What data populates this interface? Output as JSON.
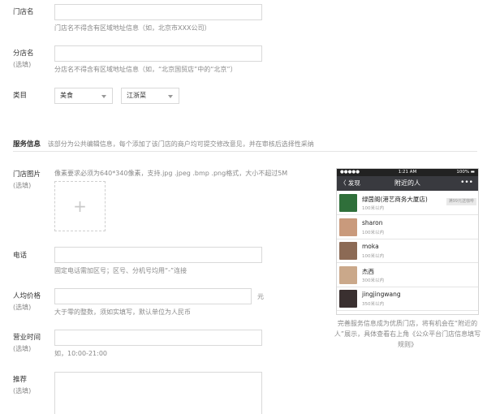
{
  "form": {
    "store_name": {
      "label": "门店名",
      "hint": "门店名不得含有区域地址信息（如，北京市XXX公司）"
    },
    "branch_name": {
      "label": "分店名",
      "optional": "(选填)",
      "hint": "分店名不得含有区域地址信息（如，“北京国贸店”中的“北京”）"
    },
    "category": {
      "label": "类目",
      "primary": "美食",
      "secondary": "江浙菜"
    },
    "service_section": {
      "title": "服务信息",
      "desc": "该部分为公共编辑信息，每个添加了该门店的商户均可提交修改意见，并在审核后选择性采纳"
    },
    "photos": {
      "label": "门店图片",
      "optional": "(选填)",
      "hint": "像素要求必须为640*340像素，支持.jpg .jpeg .bmp .png格式，大小不超过5M",
      "plus": "+"
    },
    "phone": {
      "label": "电话",
      "hint": "固定电话需加区号；区号、分机号均用“-”连接"
    },
    "avg_price": {
      "label": "人均价格",
      "optional": "(选填)",
      "unit": "元",
      "hint": "大于零的整数，须如实填写，默认单位为人民币"
    },
    "hours": {
      "label": "营业时间",
      "optional": "(选填)",
      "hint": "如，10:00-21:00"
    },
    "recommend": {
      "label": "推荐",
      "optional": "(选填)"
    }
  },
  "preview": {
    "status_left": "●●●●●",
    "status_time": "1:21 AM",
    "status_right": "100% ▬",
    "back_label": "〈 发现",
    "title": "附近的人",
    "more": "•••",
    "rows": [
      {
        "name": "绿茵阁(港艺商务大厦店)",
        "distance": "100米以内",
        "tag": "满99元送咖啡",
        "avatar_color": "#2f6f3a"
      },
      {
        "name": "sharon",
        "distance": "100米以内",
        "avatar_color": "#c99a7c"
      },
      {
        "name": "moka",
        "distance": "100米以内",
        "avatar_color": "#8c6a55"
      },
      {
        "name": "杰西",
        "distance": "300米以内",
        "avatar_color": "#caa88a"
      },
      {
        "name": "jingjingwang",
        "distance": "350米以内",
        "avatar_color": "#3a3030"
      }
    ],
    "caption": "完善服务信息成为优质门店，将有机会在“附近的人”展示，具体查看右上角《公众平台门店信息填写规则》"
  }
}
